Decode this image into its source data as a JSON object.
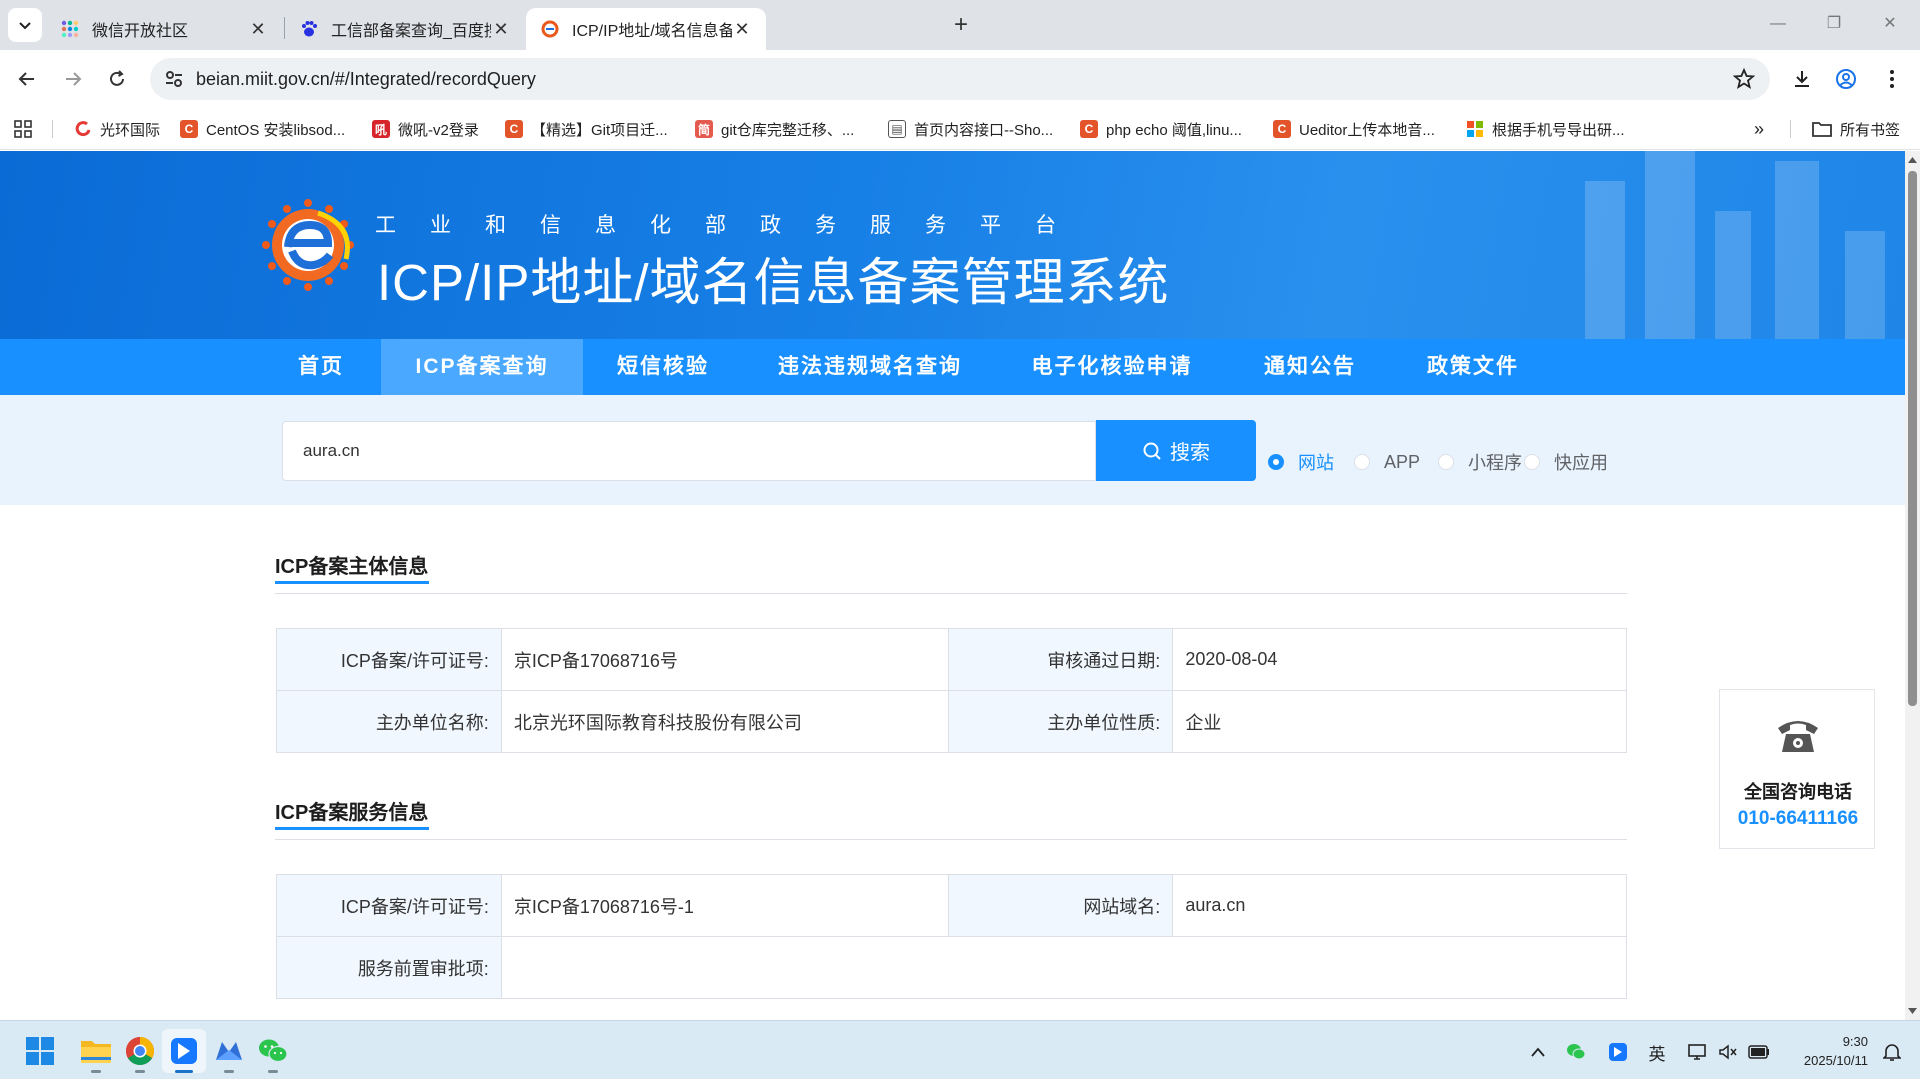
{
  "browser": {
    "tabs": [
      {
        "title": "微信开放社区",
        "favicon": "wechat-community-icon"
      },
      {
        "title": "工信部备案查询_百度搜索",
        "favicon": "baidu-paw-icon"
      },
      {
        "title": "ICP/IP地址/域名信息备案管理系",
        "favicon": "miit-logo-icon",
        "active": true
      }
    ],
    "url": "beian.miit.gov.cn/#/Integrated/recordQuery",
    "bookmarks": [
      {
        "label": "光环国际",
        "color": "#e53935"
      },
      {
        "label": "CentOS 安装libsod...",
        "color": "#e4542b",
        "glyph": "C"
      },
      {
        "label": "微吼-v2登录",
        "color": "#d6262b",
        "glyph": "吼"
      },
      {
        "label": "【精选】Git项目迁...",
        "color": "#e4542b",
        "glyph": "C"
      },
      {
        "label": "git仓库完整迁移、...",
        "color": "#e55a4e",
        "glyph": "简"
      },
      {
        "label": "首页内容接口--Sho...",
        "color": "#555555",
        "glyph": "▤"
      },
      {
        "label": "php echo 阈值,linu...",
        "color": "#e4542b",
        "glyph": "C"
      },
      {
        "label": "Ueditor上传本地音...",
        "color": "#e4542b",
        "glyph": "C"
      },
      {
        "label": "根据手机号导出研...",
        "color": "#f4b400",
        "glyph": ""
      }
    ],
    "all_bookmarks": "所有书签"
  },
  "banner": {
    "subtitle": "工业和信息化部政务服务平台",
    "title": "ICP/IP地址/域名信息备案管理系统"
  },
  "nav": [
    {
      "label": "首页"
    },
    {
      "label": "ICP备案查询",
      "active": true
    },
    {
      "label": "短信核验"
    },
    {
      "label": "违法违规域名查询"
    },
    {
      "label": "电子化核验申请"
    },
    {
      "label": "通知公告"
    },
    {
      "label": "政策文件"
    }
  ],
  "search": {
    "value": "aura.cn",
    "button": "搜索",
    "options": [
      {
        "label": "网站",
        "checked": true
      },
      {
        "label": "APP",
        "checked": false
      },
      {
        "label": "小程序",
        "checked": false
      },
      {
        "label": "快应用",
        "checked": false
      }
    ]
  },
  "subject_section": {
    "title": "ICP备案主体信息",
    "rows": [
      {
        "label1": "ICP备案/许可证号:",
        "value1": "京ICP备17068716号",
        "label2": "审核通过日期:",
        "value2": "2020-08-04"
      },
      {
        "label1": "主办单位名称:",
        "value1": "北京光环国际教育科技股份有限公司",
        "label2": "主办单位性质:",
        "value2": "企业"
      }
    ]
  },
  "service_section": {
    "title": "ICP备案服务信息",
    "rows": [
      {
        "label1": "ICP备案/许可证号:",
        "value1": "京ICP备17068716号-1",
        "label2": "网站域名:",
        "value2": "aura.cn"
      },
      {
        "label1": "服务前置审批项:",
        "value1": ""
      }
    ]
  },
  "hotline": {
    "label": "全国咨询电话",
    "number": "010-66411166"
  },
  "taskbar": {
    "apps": [
      "windows-start-icon",
      "file-explorer-icon",
      "chrome-icon",
      "feishu-lark-icon",
      "email-app-icon",
      "wechat-icon"
    ],
    "ime": "英",
    "time": "9:30",
    "date": "2025/10/11"
  }
}
